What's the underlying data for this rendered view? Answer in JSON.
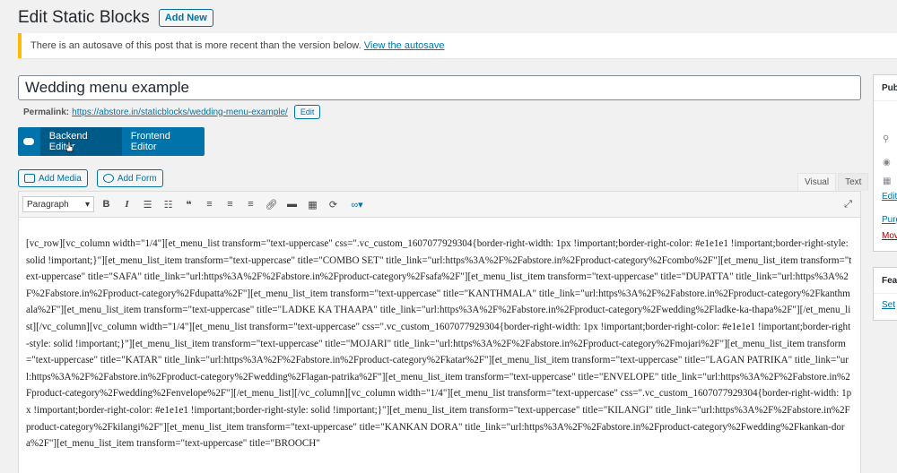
{
  "header": {
    "title": "Edit Static Blocks",
    "add_new_label": "Add New"
  },
  "notice": {
    "text": "There is an autosave of this post that is more recent than the version below.",
    "link": "View the autosave",
    "accent_color": "#ffb900"
  },
  "post": {
    "title": "Wedding menu example"
  },
  "permalink": {
    "label": "Permalink:",
    "url": "https://abstore.in/staticblocks/wedding-menu-example/",
    "edit_label": "Edit"
  },
  "composer": {
    "backend_label": "Backend Editor",
    "frontend_label": "Frontend Editor",
    "brand_color": "#0073aa"
  },
  "media": {
    "add_media_label": "Add Media",
    "add_form_label": "Add Form"
  },
  "editor_tabs": {
    "visual": "Visual",
    "text": "Text",
    "active": "Visual"
  },
  "toolbar": {
    "format_value": "Paragraph",
    "buttons": [
      "bold-icon",
      "italic-icon",
      "bulleted-list-icon",
      "numbered-list-icon",
      "blockquote-icon",
      "align-left-icon",
      "align-center-icon",
      "align-right-icon",
      "link-icon",
      "read-more-icon",
      "toolbar-toggle-icon",
      "refresh-icon",
      "infinity-icon",
      "fullscreen-icon"
    ]
  },
  "editor": {
    "content": "[vc_row][vc_column width=\"1/4\"][et_menu_list transform=\"text-uppercase\" css=\".vc_custom_1607077929304{border-right-width: 1px !important;border-right-color: #e1e1e1 !important;border-right-style: solid !important;}\"][et_menu_list_item transform=\"text-uppercase\" title=\"COMBO SET\" title_link=\"url:https%3A%2F%2Fabstore.in%2Fproduct-category%2Fcombo%2F\"][et_menu_list_item transform=\"text-uppercase\" title=\"SAFA\" title_link=\"url:https%3A%2F%2Fabstore.in%2Fproduct-category%2Fsafa%2F\"][et_menu_list_item transform=\"text-uppercase\" title=\"DUPATTA\" title_link=\"url:https%3A%2F%2Fabstore.in%2Fproduct-category%2Fdupatta%2F\"][et_menu_list_item transform=\"text-uppercase\" title=\"KANTHMALA\" title_link=\"url:https%3A%2F%2Fabstore.in%2Fproduct-category%2Fkanthmala%2F\"][et_menu_list_item transform=\"text-uppercase\" title=\"LADKE KA THAAPA\" title_link=\"url:https%3A%2F%2Fabstore.in%2Fproduct-category%2Fwedding%2Fladke-ka-thapa%2F\"][/et_menu_list][/vc_column][vc_column width=\"1/4\"][et_menu_list transform=\"text-uppercase\" css=\".vc_custom_1607077929304{border-right-width: 1px !important;border-right-color: #e1e1e1 !important;border-right-style: solid !important;}\"][et_menu_list_item transform=\"text-uppercase\" title=\"MOJARI\" title_link=\"url:https%3A%2F%2Fabstore.in%2Fproduct-category%2Fmojari%2F\"][et_menu_list_item transform=\"text-uppercase\" title=\"KATAR\" title_link=\"url:https%3A%2F%2Fabstore.in%2Fproduct-category%2Fkatar%2F\"][et_menu_list_item transform=\"text-uppercase\" title=\"LAGAN PATRIKA\" title_link=\"url:https%3A%2F%2Fabstore.in%2Fproduct-category%2Fwedding%2Flagan-patrika%2F\"][et_menu_list_item transform=\"text-uppercase\" title=\"ENVELOPE\" title_link=\"url:https%3A%2F%2Fabstore.in%2Fproduct-category%2Fwedding%2Fenvelope%2F\"][/et_menu_list][/vc_column][vc_column width=\"1/4\"][et_menu_list transform=\"text-uppercase\" css=\".vc_custom_1607077929304{border-right-width: 1px !important;border-right-color: #e1e1e1 !important;border-right-style: solid !important;}\"][et_menu_list_item transform=\"text-uppercase\" title=\"KILANGI\" title_link=\"url:https%3A%2F%2Fabstore.in%2Fproduct-category%2Fkilangi%2F\"][et_menu_list_item transform=\"text-uppercase\" title=\"KANKAN DORA\" title_link=\"url:https%3A%2F%2Fabstore.in%2Fproduct-category%2Fwedding%2Fkankan-dora%2F\"][et_menu_list_item transform=\"text-uppercase\" title=\"BROOCH\""
  },
  "sidebar": {
    "publish_title": "Pub",
    "edit_link": "Edit",
    "purge_link": "Purg",
    "move_link": "Mov",
    "featured_title": "Fea",
    "set_link": "Set"
  }
}
